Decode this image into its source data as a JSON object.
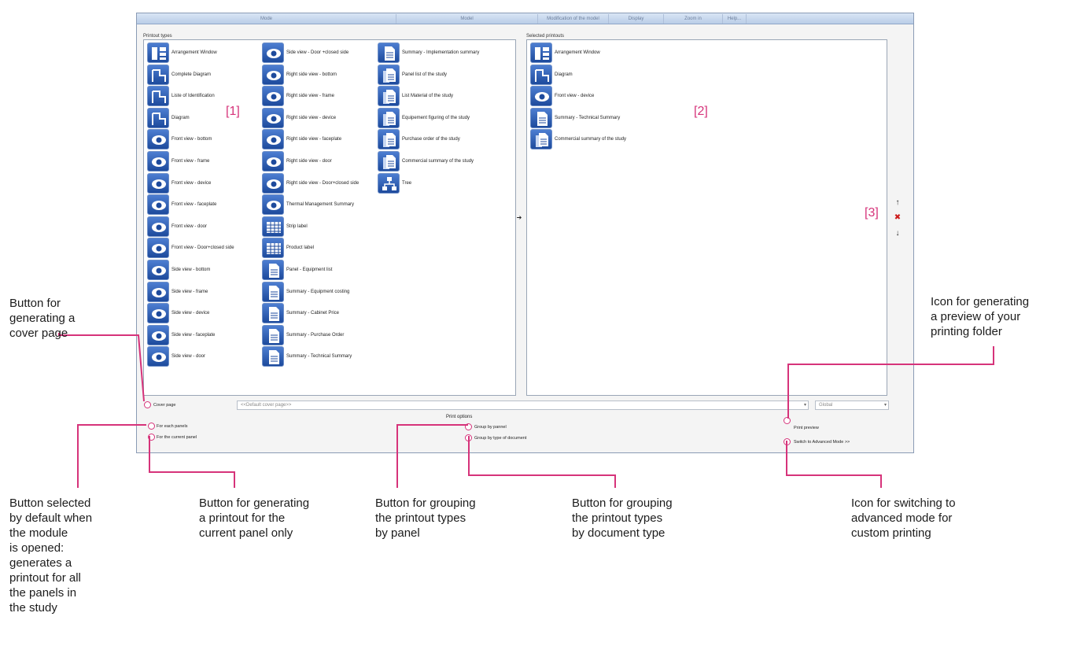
{
  "menubar": {
    "items": [
      "Mode",
      "Model",
      "Modification of the model",
      "Display",
      "Zoom in",
      "Help..."
    ]
  },
  "printout_types": {
    "title": "Printout types",
    "columns": [
      [
        {
          "label": "Arrangement Window",
          "icon": "arrangement-icon"
        },
        {
          "label": "Complete Diagram",
          "icon": "diagram-icon"
        },
        {
          "label": "Liste of Identification",
          "icon": "diagram-icon"
        },
        {
          "label": "Diagram",
          "icon": "diagram-icon"
        },
        {
          "label": "Front view - bottom",
          "icon": "eye-icon"
        },
        {
          "label": "Front view - frame",
          "icon": "eye-icon"
        },
        {
          "label": "Front view - device",
          "icon": "eye-icon"
        },
        {
          "label": "Front view - faceplate",
          "icon": "eye-icon"
        },
        {
          "label": "Front view - door",
          "icon": "eye-icon"
        },
        {
          "label": "Front view - Door+closed side",
          "icon": "eye-icon"
        },
        {
          "label": "Side view - bottom",
          "icon": "eye-icon"
        },
        {
          "label": "Side view - frame",
          "icon": "eye-icon"
        },
        {
          "label": "Side view - device",
          "icon": "eye-icon"
        },
        {
          "label": "Side view - faceplate",
          "icon": "eye-icon"
        },
        {
          "label": "Side view - door",
          "icon": "eye-icon"
        }
      ],
      [
        {
          "label": "Side view - Door +closed side",
          "icon": "eye-icon"
        },
        {
          "label": "Right side view - bottom",
          "icon": "eye-icon"
        },
        {
          "label": "Right side view - frame",
          "icon": "eye-icon"
        },
        {
          "label": "Right side view - device",
          "icon": "eye-icon"
        },
        {
          "label": "Right side view - faceplate",
          "icon": "eye-icon"
        },
        {
          "label": "Right side view - door",
          "icon": "eye-icon"
        },
        {
          "label": "Right side view - Door+closed side",
          "icon": "eye-icon"
        },
        {
          "label": "Thermal Management Summary",
          "icon": "eye-icon"
        },
        {
          "label": "Strip label",
          "icon": "grid-icon"
        },
        {
          "label": "Product label",
          "icon": "grid-icon"
        },
        {
          "label": "Panel - Equipment list",
          "icon": "document-icon"
        },
        {
          "label": "Summary - Equipment costing",
          "icon": "document-icon"
        },
        {
          "label": "Summary - Cabinet Price",
          "icon": "document-icon"
        },
        {
          "label": "Summary - Purchase Order",
          "icon": "document-icon"
        },
        {
          "label": "Summary - Technical Summary",
          "icon": "document-icon"
        }
      ],
      [
        {
          "label": "Summary - Implementation summary",
          "icon": "document-icon"
        },
        {
          "label": "Panel list of the study",
          "icon": "document-stack-icon"
        },
        {
          "label": "List Material of the study",
          "icon": "document-stack-icon"
        },
        {
          "label": "Equipement figuring of the study",
          "icon": "document-stack-icon"
        },
        {
          "label": "Purchase order of the study",
          "icon": "document-stack-icon"
        },
        {
          "label": "Commercial summary of the study",
          "icon": "document-stack-icon"
        },
        {
          "label": "Tree",
          "icon": "tree-icon"
        }
      ]
    ]
  },
  "selected_printouts": {
    "title": "Selected printouts",
    "items": [
      {
        "label": "Arrangement Window",
        "icon": "arrangement-icon"
      },
      {
        "label": "Diagram",
        "icon": "diagram-icon"
      },
      {
        "label": "Front view - device",
        "icon": "eye-icon"
      },
      {
        "label": "Summary - Technical Summary",
        "icon": "document-icon"
      },
      {
        "label": "Commercial summary of the study",
        "icon": "document-stack-icon"
      }
    ]
  },
  "markers": {
    "m1": "[1]",
    "m2": "[2]",
    "m3": "[3]"
  },
  "side_buttons": {
    "add": "➔",
    "up": "↑",
    "delete": "✖",
    "down": "↓"
  },
  "cover_page": {
    "label": "Cover page",
    "value": "<<Default cover page>>",
    "scope": "Global"
  },
  "print_options": {
    "title": "Print options",
    "for_each_panels": "For each panels",
    "for_current_panel": "For the current panel",
    "group_by_panel": "Group by pannel",
    "group_by_doc_type": "Group by type of document",
    "print_preview": "Print preview",
    "advanced_mode": "Switch to Advanced Mode >>"
  },
  "annotations": {
    "cover_page": [
      "Button for",
      "generating a",
      "cover page"
    ],
    "preview": [
      "Icon for generating",
      "a preview of your",
      "printing folder"
    ],
    "each_panel": [
      "Button selected",
      "by default when",
      "the module",
      "is opened:",
      "generates a",
      "printout for all",
      "the panels in",
      "the study"
    ],
    "current_panel": [
      "Button for generating",
      "a printout for the",
      "current panel only"
    ],
    "group_panel": [
      "Button for grouping",
      "the printout types",
      "by panel"
    ],
    "group_doc": [
      "Button for grouping",
      "the printout types",
      "by document type"
    ],
    "advanced": [
      "Icon for switching to",
      "advanced mode for",
      "custom printing"
    ]
  },
  "colors": {
    "accent": "#d6337a",
    "icon_blue": "#2a5ab0",
    "delete_red": "#cc1a1a"
  }
}
